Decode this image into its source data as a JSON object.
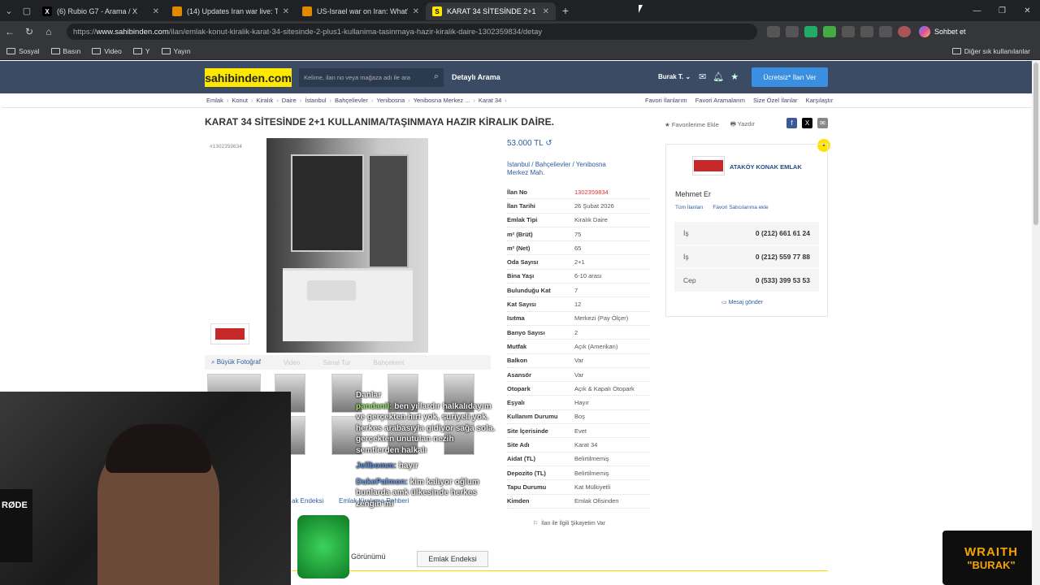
{
  "browser": {
    "tabs": [
      {
        "title": "(6) Rubio G7 - Arama / X",
        "icon": "x-icon",
        "color": "#000000"
      },
      {
        "title": "(14) Updates Iran war live: Trump a",
        "icon": "news-icon",
        "color": "#e08a00"
      },
      {
        "title": "US-Israel war on Iran: What's happ",
        "icon": "news-icon",
        "color": "#e08a00"
      },
      {
        "title": "KARAT 34 SİTESİNDE 2+1 KULLANI",
        "icon": "sahibinden-icon",
        "color": "#ffe800"
      }
    ],
    "url_prefix": "https://",
    "url_host": "www.sahibinden.com",
    "url_path": "/ilan/emlak-konut-kiralik-karat-34-sitesinde-2-plus1-kullanima-tasinmaya-hazir-kiralik-daire-1302359834/detay",
    "copilot_label": "Sohbet et",
    "bookmarks": [
      "Sosyal",
      "Basın",
      "Video",
      "Y",
      "Yayın"
    ],
    "bookmarks_right": "Diğer sık kullanılanlar"
  },
  "site": {
    "logo": "sahibinden.com",
    "search_placeholder": "Kelime, ilan no veya mağaza adı ile ara",
    "detailed_search": "Detaylı Arama",
    "user": "Burak T.",
    "cta": "Ücretsiz* İlan Ver"
  },
  "breadcrumb": [
    "Emlak",
    "Konut",
    "Kiralık",
    "Daire",
    "İstanbul",
    "Bahçelievler",
    "Yenibosna",
    "Yenibosna Merkez ...",
    "Karat 34"
  ],
  "breadcrumb_right": [
    "Favori İlanlarım",
    "Favori Aramalarım",
    "Size Özel İlanlar",
    "Karşılaştır"
  ],
  "listing": {
    "title": "KARAT 34 SİTESİNDE 2+1 KULLANIMA/TAŞINMAYA HAZIR KİRALIK DAİRE.",
    "fav": "Favorilerime Ekle",
    "print": "Yazdır",
    "id_label": "#1302359834",
    "price": "53.000 TL",
    "location_line1": "İstanbul  /  Bahçelievler  /  Yenibosna",
    "location_line2": "Merkez Mah.",
    "photo_tabs": [
      "Büyük Fotoğraf",
      "Video",
      "Sanal Tur",
      "Bahçekent"
    ],
    "complaint": "İlan ile İlgili Şikayetim Var"
  },
  "details": [
    {
      "k": "İlan No",
      "v": "1302359834",
      "red": true
    },
    {
      "k": "İlan Tarihi",
      "v": "26 Şubat 2026"
    },
    {
      "k": "Emlak Tipi",
      "v": "Kiralık Daire"
    },
    {
      "k": "m² (Brüt)",
      "v": "75"
    },
    {
      "k": "m² (Net)",
      "v": "65"
    },
    {
      "k": "Oda Sayısı",
      "v": "2+1"
    },
    {
      "k": "Bina Yaşı",
      "v": "6-10 arası"
    },
    {
      "k": "Bulunduğu Kat",
      "v": "7"
    },
    {
      "k": "Kat Sayısı",
      "v": "12"
    },
    {
      "k": "Isıtma",
      "v": "Merkezi (Pay Ölçer)"
    },
    {
      "k": "Banyo Sayısı",
      "v": "2"
    },
    {
      "k": "Mutfak",
      "v": "Açık (Amerikan)"
    },
    {
      "k": "Balkon",
      "v": "Var"
    },
    {
      "k": "Asansör",
      "v": "Var"
    },
    {
      "k": "Otopark",
      "v": "Açık & Kapalı Otopark"
    },
    {
      "k": "Eşyalı",
      "v": "Hayır"
    },
    {
      "k": "Kullanım Durumu",
      "v": "Boş"
    },
    {
      "k": "Site İçerisinde",
      "v": "Evet"
    },
    {
      "k": "Site Adı",
      "v": "Karat 34"
    },
    {
      "k": "Aidat (TL)",
      "v": "Belirtilmemiş"
    },
    {
      "k": "Depozito (TL)",
      "v": "Belirtilmemiş"
    },
    {
      "k": "Tapu Durumu",
      "v": "Kat Mülkiyetli"
    },
    {
      "k": "Kimden",
      "v": "Emlak Ofisinden"
    }
  ],
  "seller": {
    "agency": "ATAKÖY KONAK EMLAK",
    "name": "Mehmet Er",
    "all_listings": "Tüm İlanları",
    "add_fav": "Favori Satıcılarıma ekle",
    "phones": [
      {
        "label": "İş",
        "number": "0 (212) 661 61 24"
      },
      {
        "label": "İş",
        "number": "0 (212) 559 77 88"
      },
      {
        "label": "Cep",
        "number": "0 (533) 399 53 53"
      }
    ],
    "message": "Mesaj gönder"
  },
  "overlay": {
    "rode": "RØDE",
    "chat": [
      {
        "user": "",
        "text": "Danlar"
      },
      {
        "user": "pandanil:",
        "text": " ben yıllardır halkalıdayım ve gerçekten hırt yok, suriyeli yok. herkes arabasıyla gidiyor sağa sola. gerçekten unutulan nezih semtlerden halkalı"
      },
      {
        "user": "Jellbomm:",
        "text": " hayır"
      },
      {
        "user": "DukePalmon:",
        "text": " kim kalıyor oğlum bunlarda amk ülkesinde herkes zengin mi"
      }
    ],
    "tab_left": "ak Endeksi",
    "tab_right": "Emlak Kiralama Rehberi",
    "btn_left": "ak Görünümü",
    "btn_right": "Emlak Endeksi",
    "brand1": "WRAITH",
    "brand2": "\"BURAK\""
  }
}
